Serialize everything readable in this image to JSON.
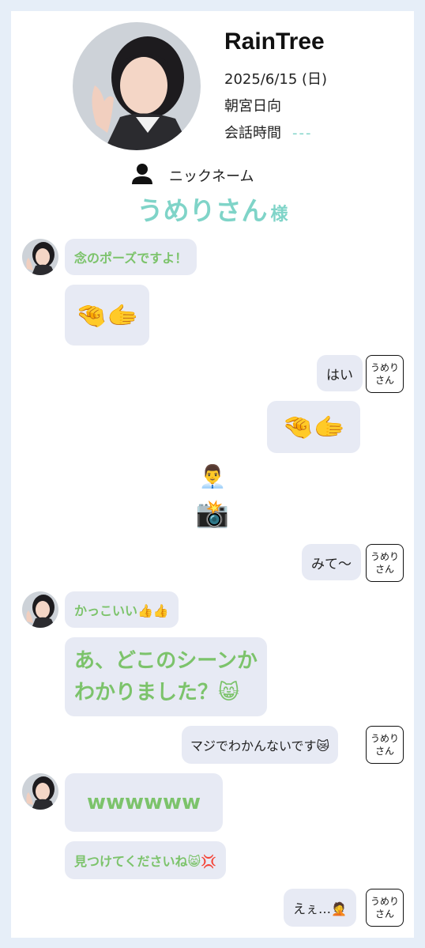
{
  "header": {
    "title": "RainTree",
    "date": "2025/6/15 (日)",
    "member": "朝宮日向",
    "talk_time_label": "会話時間",
    "talk_time_value": "---",
    "nickname_label": "ニックネーム",
    "nickname": "うめりさん",
    "nickname_suffix": "様"
  },
  "user_tag": {
    "line1": "うめり",
    "line2": "さん"
  },
  "messages": [
    {
      "side": "left",
      "text": "念のポーズですよ！"
    },
    {
      "side": "left",
      "text": "🤏🫱"
    },
    {
      "side": "right",
      "text": "はい"
    },
    {
      "side": "right",
      "text": "🤏🫱"
    },
    {
      "side": "center",
      "text": "👨‍💼"
    },
    {
      "side": "center",
      "text": "📸"
    },
    {
      "side": "right",
      "text": "みて〜"
    },
    {
      "side": "left",
      "text": "かっこいい👍👍"
    },
    {
      "side": "left",
      "line1": "あ、どこのシーンか",
      "line2": "わかりました？😸"
    },
    {
      "side": "right",
      "text": "マジでわかんないです😿"
    },
    {
      "side": "left",
      "text": "wwwwww"
    },
    {
      "side": "left",
      "text": "見つけてくださいね😸💢"
    },
    {
      "side": "right",
      "text": "えぇ…🤦"
    }
  ],
  "colors": {
    "accent": "#7fd4c8",
    "green_text": "#7cc36b",
    "bubble": "#e7eaf4",
    "page_bg": "#e6eef8"
  }
}
